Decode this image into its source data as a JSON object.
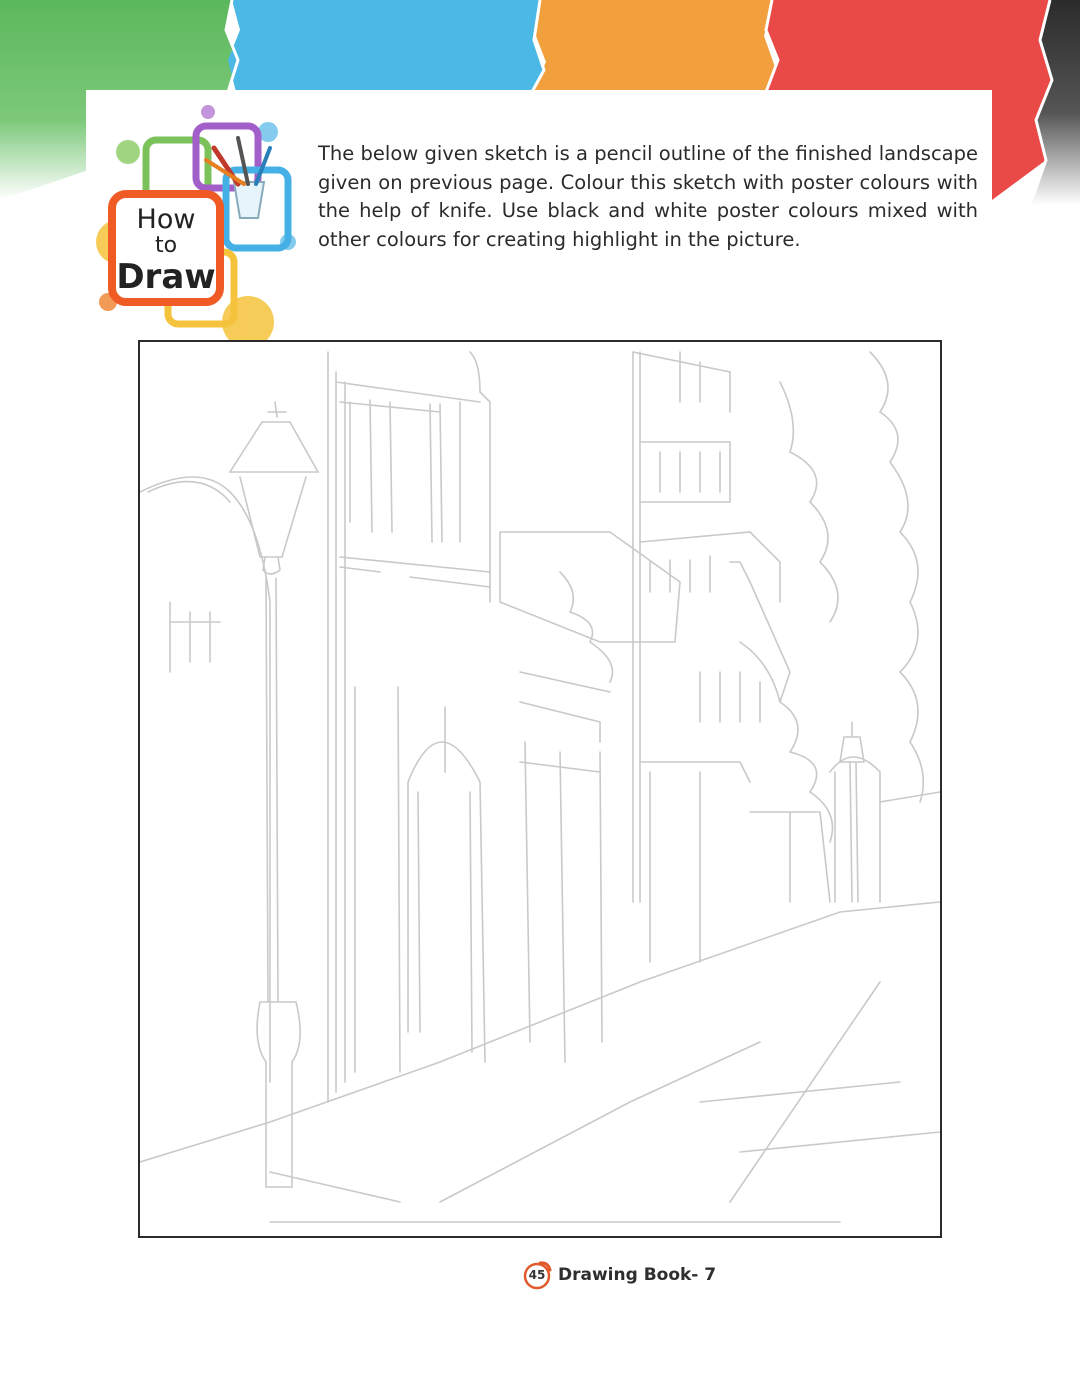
{
  "instructions": {
    "text": "The below given sketch is a pencil outline of the finished landscape given on previous page. Colour this sketch with poster colours with the help of knife. Use black and white poster colours mixed with other colours for creating highlight in the picture."
  },
  "logo": {
    "line1": "How",
    "line2": "to",
    "line3": "Draw",
    "icon": "paint-brushes-cup-icon"
  },
  "banner": {
    "colors": [
      "#5cb85c",
      "#4cb8e6",
      "#f2a03d",
      "#ea4a47",
      "#2b2b2b"
    ]
  },
  "footer": {
    "page_number": "45",
    "book_title": "Drawing Book- 7"
  }
}
